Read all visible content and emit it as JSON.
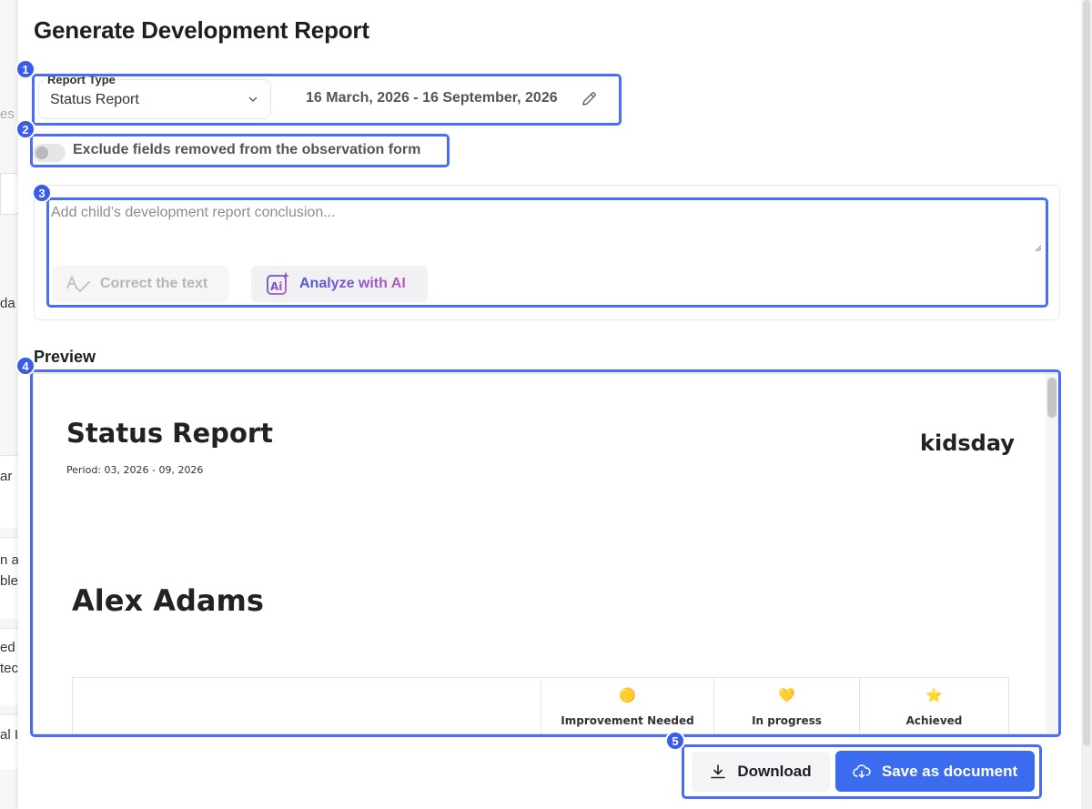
{
  "background": {
    "fragments": [
      "es",
      "da",
      "ar",
      "n a",
      "ble",
      "ed",
      "tec",
      "al I"
    ]
  },
  "modal": {
    "title": "Generate Development Report",
    "report_type": {
      "label": "Report Type",
      "value": "Status Report"
    },
    "date_range": "16 March, 2026 - 16 September, 2026",
    "exclude_toggle": {
      "label": "Exclude fields removed from the observation form",
      "checked": false
    },
    "conclusion": {
      "placeholder": "Add child's development report conclusion...",
      "value": ""
    },
    "buttons": {
      "correct_text": "Correct the text",
      "analyze_ai": "Analyze with AI",
      "download": "Download",
      "save_document": "Save as document"
    },
    "preview_heading": "Preview"
  },
  "preview": {
    "title": "Status Report",
    "period": "Period: 03, 2026 - 09, 2026",
    "brand": "kidsday",
    "child_name": "Alex Adams",
    "table_columns": [
      {
        "emoji": "🟡",
        "label": "Improvement Needed"
      },
      {
        "emoji": "💛",
        "label": "In progress"
      },
      {
        "emoji": "⭐",
        "label": "Achieved"
      }
    ]
  },
  "annotations": [
    "1",
    "2",
    "3",
    "4",
    "5"
  ],
  "colors": {
    "accent": "#3b6cf0",
    "annotation": "#4a6cf7"
  }
}
